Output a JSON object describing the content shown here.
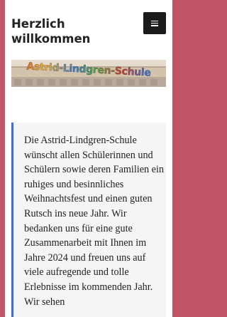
{
  "header": {
    "title": "Herzlich willkommen",
    "menu_icon": "hamburger-menu-icon"
  },
  "banner": {
    "text": "Astrid-Lindgren-Schule"
  },
  "article": {
    "body": "Die Astrid-Lindgren-Schule wünscht allen Schülerinnen und Schülern sowie deren Familien ein ruhiges und besinnliches Weihnachtsfest und einen guten Rutsch ins neue Jahr. Wir bedanken uns für eine gute Zusammenarbeit mit Ihnen im Jahre 2024 und freuen uns auf viele aufregende und tolle Erlebnisse im kommenden Jahr. Wir sehen"
  },
  "colors": {
    "page_border": "#c05568",
    "accent": "#3b6fd4",
    "menu_button": "#1b1b1b"
  }
}
